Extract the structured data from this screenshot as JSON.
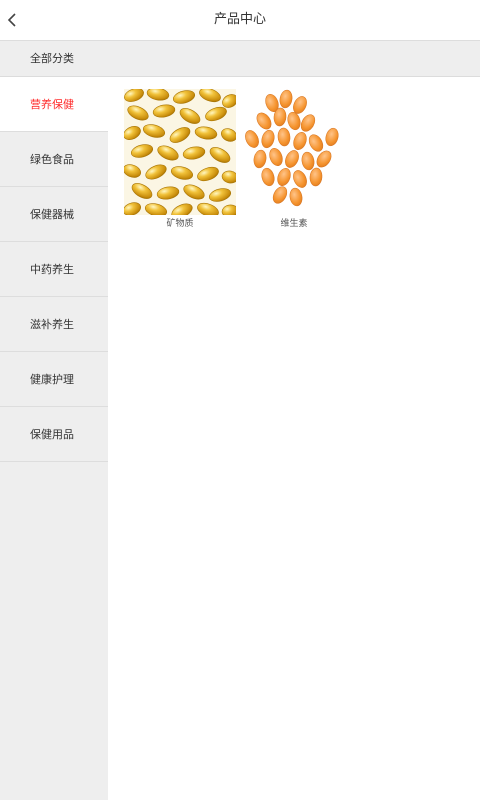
{
  "header": {
    "title": "产品中心",
    "back_icon": "chevron-left-icon"
  },
  "category_bar": {
    "label": "全部分类"
  },
  "sidebar": {
    "items": [
      {
        "label": "营养保健",
        "active": true
      },
      {
        "label": "绿色食品",
        "active": false
      },
      {
        "label": "保健器械",
        "active": false
      },
      {
        "label": "中药养生",
        "active": false
      },
      {
        "label": "滋补养生",
        "active": false
      },
      {
        "label": "健康护理",
        "active": false
      },
      {
        "label": "保健用品",
        "active": false
      }
    ]
  },
  "products": [
    {
      "name": "矿物质",
      "image": "golden softgel capsules"
    },
    {
      "name": "维生素",
      "image": "orange vitamin tablets"
    }
  ],
  "colors": {
    "active": "#ff2a2a",
    "sidebar_bg": "#eeeeee",
    "divider": "#dddddd"
  }
}
